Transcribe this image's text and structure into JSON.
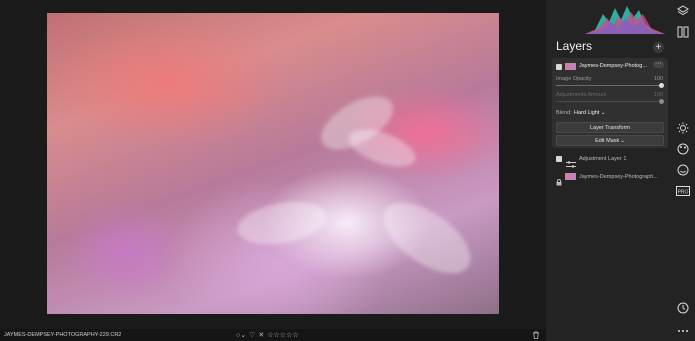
{
  "photo": {
    "filename": "JAYMES-DEMPSEY-PHOTOGRAPHY-229.CR2"
  },
  "layers_panel": {
    "title": "Layers",
    "add_icon": "plus-icon",
    "active_layer": {
      "name": "Jaymes-Dempsey-Photog...",
      "image_opacity_label": "Image Opacity",
      "image_opacity_value": "100",
      "adjustments_amount_label": "Adjustments Amount",
      "adjustments_amount_value": "100",
      "blend_label": "Blend:",
      "blend_value": "Hard Light",
      "layer_transform_label": "Layer Transform",
      "edit_mask_label": "Edit Mask"
    },
    "other_layers": [
      {
        "name": "Adjustment Layer 1",
        "icon": "sliders-icon"
      },
      {
        "name": "Jaymes-Dempsey-Photograph...",
        "icon": "lock-icon"
      }
    ]
  },
  "rail_icons": [
    "layers-icon",
    "compare-icon",
    "sun-icon",
    "palette-icon",
    "face-icon",
    "pro-icon",
    "history-icon",
    "more-icon"
  ],
  "bottom_bar": {
    "rating_stars": 0,
    "star_count": 5
  },
  "colors": {
    "accent": "#d84a8a",
    "panel_bg": "#232323",
    "card_bg": "#303030"
  }
}
